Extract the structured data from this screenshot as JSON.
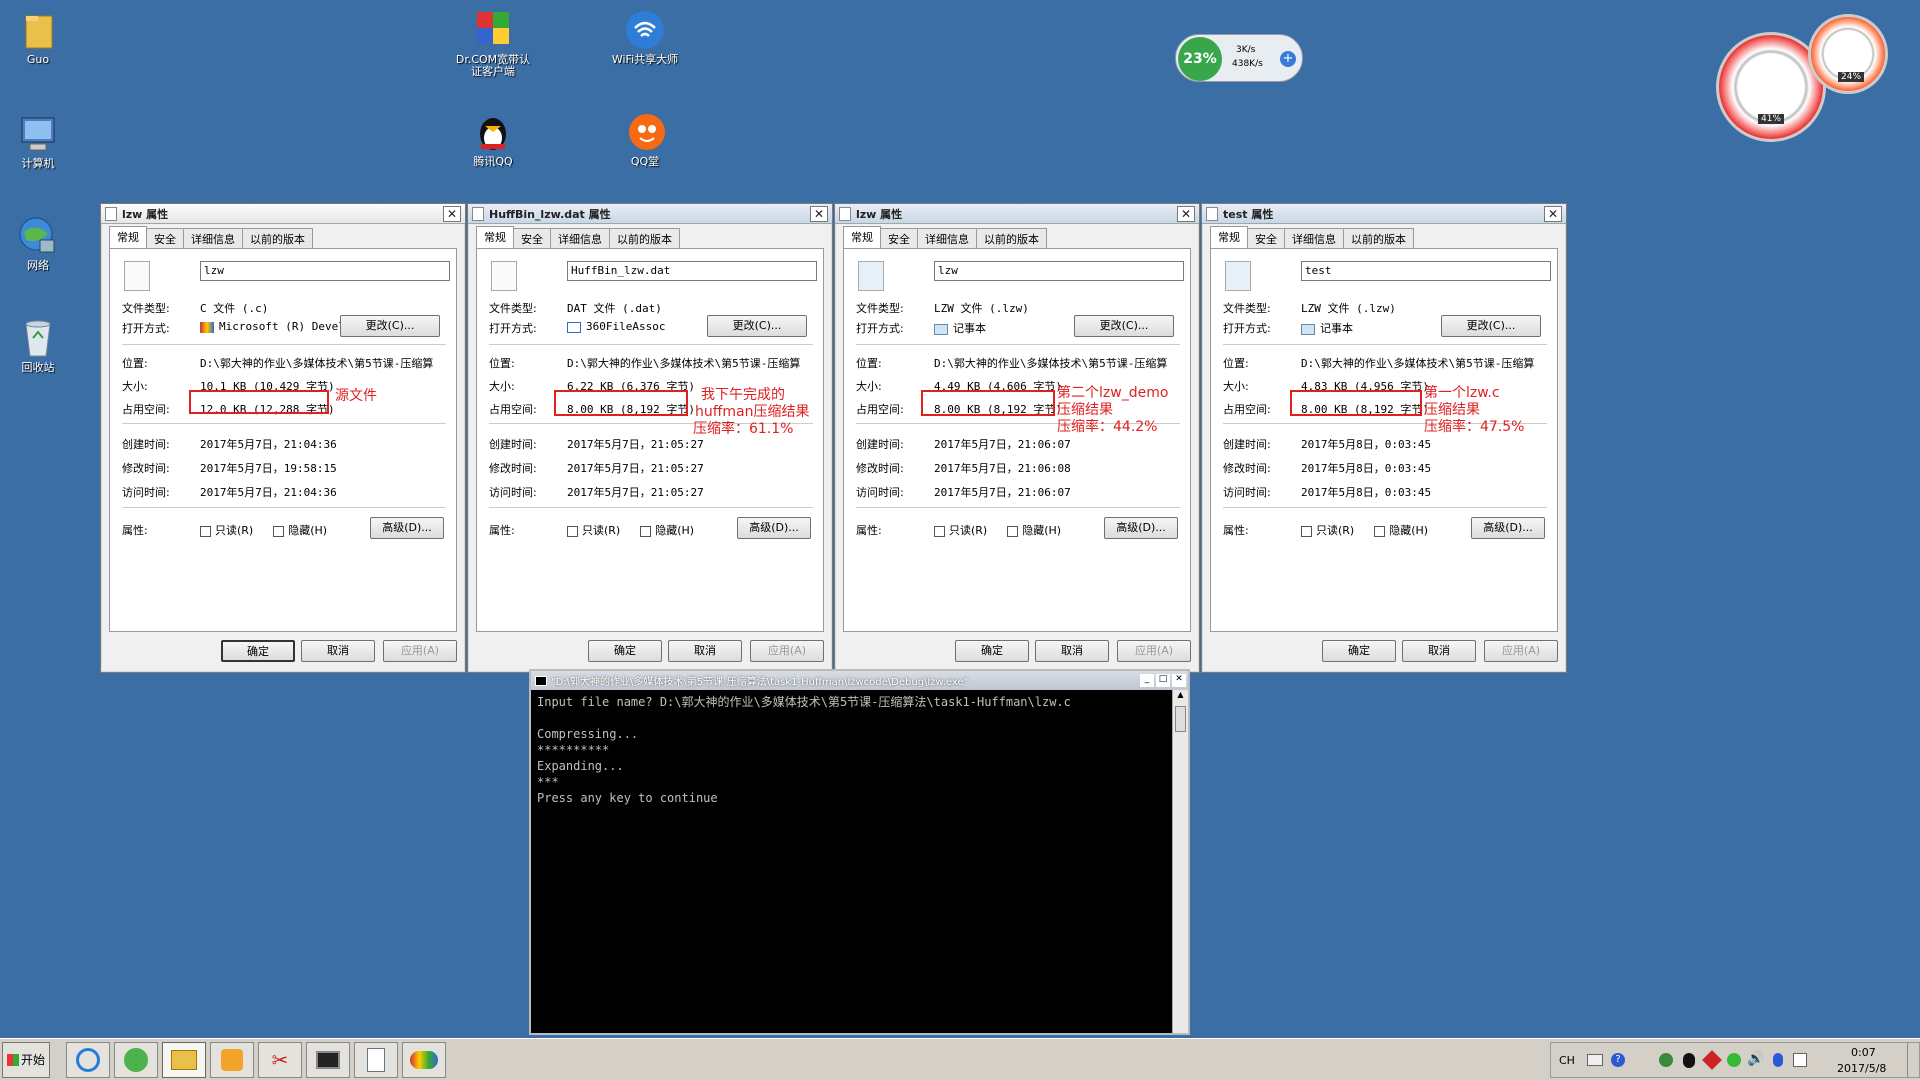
{
  "desktop": {
    "icons": [
      {
        "label": "Guo"
      },
      {
        "label": "计算机"
      },
      {
        "label": "网络"
      },
      {
        "label": "回收站"
      },
      {
        "label": "Dr.COM宽带认证客户端"
      },
      {
        "label": "WiFi共享大师"
      },
      {
        "label": "腾讯QQ"
      },
      {
        "label": "QQ堂"
      }
    ]
  },
  "widgets": {
    "net": {
      "percent": "23%",
      "up": "3K/s",
      "down": "438K/s"
    },
    "gauge": {
      "cpu": "41%",
      "mem": "24%"
    }
  },
  "tabs": [
    "常规",
    "安全",
    "详细信息",
    "以前的版本"
  ],
  "labels": {
    "type": "文件类型:",
    "open": "打开方式:",
    "loc": "位置:",
    "size": "大小:",
    "disk": "占用空间:",
    "created": "创建时间:",
    "modified": "修改时间:",
    "accessed": "访问时间:",
    "attr": "属性:",
    "readonly": "只读(R)",
    "hidden": "隐藏(H)",
    "advanced": "高级(D)...",
    "change": "更改(C)...",
    "ok": "确定",
    "cancel": "取消",
    "apply": "应用(A)"
  },
  "dialogs": [
    {
      "title": "lzw 属性",
      "filename": "lzw",
      "type": "C 文件 (.c)",
      "open_with": "Microsoft (R) Devel",
      "location": "D:\\郭大神的作业\\多媒体技术\\第5节课-压缩算",
      "size": "10.1 KB (10,429 字节)",
      "disk": "12.0 KB (12,288 字节)",
      "created": "2017年5月7日，21:04:36",
      "modified": "2017年5月7日，19:58:15",
      "accessed": "2017年5月7日，21:04:36",
      "note": [
        "源文件"
      ]
    },
    {
      "title": "HuffBin_lzw.dat 属性",
      "filename": "HuffBin_lzw.dat",
      "type": "DAT 文件 (.dat)",
      "open_with": "360FileAssoc",
      "location": "D:\\郭大神的作业\\多媒体技术\\第5节课-压缩算",
      "size": "6.22 KB (6,376 字节)",
      "disk": "8.00 KB (8,192 字节)",
      "created": "2017年5月7日，21:05:27",
      "modified": "2017年5月7日，21:05:27",
      "accessed": "2017年5月7日，21:05:27",
      "note": [
        "我下午完成的",
        "huffman压缩结果",
        "压缩率：61.1%"
      ]
    },
    {
      "title": "lzw 属性",
      "filename": "lzw",
      "type": "LZW 文件 (.lzw)",
      "open_with": "记事本",
      "location": "D:\\郭大神的作业\\多媒体技术\\第5节课-压缩算",
      "size": "4.49 KB (4,606 字节)",
      "disk": "8.00 KB (8,192 字节)",
      "created": "2017年5月7日，21:06:07",
      "modified": "2017年5月7日，21:06:08",
      "accessed": "2017年5月7日，21:06:07",
      "note": [
        "第二个lzw_demo",
        "压缩结果",
        "压缩率：44.2%"
      ]
    },
    {
      "title": "test 属性",
      "filename": "test",
      "type": "LZW 文件 (.lzw)",
      "open_with": "记事本",
      "location": "D:\\郭大神的作业\\多媒体技术\\第5节课-压缩算",
      "size": "4.83 KB (4,956 字节)",
      "disk": "8.00 KB (8,192 字节)",
      "created": "2017年5月8日，0:03:45",
      "modified": "2017年5月8日，0:03:45",
      "accessed": "2017年5月8日，0:03:45",
      "note": [
        "第一个lzw.c",
        "压缩结果",
        "压缩率：47.5%"
      ]
    }
  ],
  "console": {
    "title": "\"D:\\郭大神的作业\\多媒体技术\\第5节课-压缩算法\\task1-Huffman\\lzwcode\\Debug\\lzw.exe\"",
    "lines": [
      "Input file name? D:\\郭大神的作业\\多媒体技术\\第5节课-压缩算法\\task1-Huffman\\lzw.c",
      "",
      "Compressing...",
      "**********",
      "Expanding...",
      "***",
      "Press any key to continue"
    ]
  },
  "taskbar": {
    "start": "开始",
    "lang": "CH",
    "time": "0:07",
    "date": "2017/5/8"
  }
}
